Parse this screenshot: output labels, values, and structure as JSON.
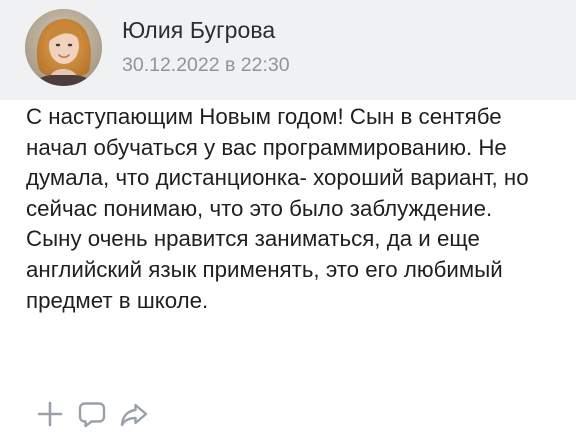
{
  "post": {
    "author": {
      "name": "Юлия Бугрова",
      "avatar_icon": "user-photo-avatar"
    },
    "date": "30.12.2022 в 22:30",
    "text": "С наступающим Новым годом! Сын в сентябе начал обучаться у вас программированию. Не думала, что дистанционка- хороший вариант, но сейчас понимаю, что это было заблуждение. Сыну очень нравится заниматься, да и еще английский язык применять, это его любимый предмет в школе."
  },
  "actions": [
    {
      "icon": "plus-icon"
    },
    {
      "icon": "comment-icon"
    },
    {
      "icon": "share-icon"
    }
  ],
  "colors": {
    "header_background": "#f0f1f3",
    "author_text": "#2b2d31",
    "date_text": "#8f949c",
    "body_text": "#1d1f22",
    "action_icon": "#9ba1aa"
  }
}
